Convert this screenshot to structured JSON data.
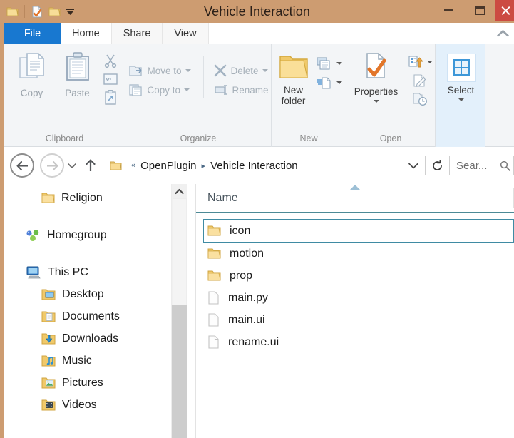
{
  "window": {
    "title": "Vehicle Interaction",
    "titlebar_color": "#cd9c71",
    "close_color": "#cc4b42",
    "accent_color": "#1878d0"
  },
  "quick_access": {
    "items": [
      {
        "name": "system-menu-folder",
        "icon": "folder-icon"
      },
      {
        "name": "properties",
        "icon": "properties-icon"
      },
      {
        "name": "new-folder",
        "icon": "new-folder-icon"
      },
      {
        "name": "customize-dropdown",
        "icon": "chevron-down-icon"
      }
    ]
  },
  "window_controls": {
    "minimize": "Minimize",
    "maximize": "Maximize",
    "close": "Close"
  },
  "tabs": {
    "file": "File",
    "items": [
      {
        "label": "Home",
        "active": true
      },
      {
        "label": "Share",
        "active": false
      },
      {
        "label": "View",
        "active": false
      }
    ],
    "collapse_ribbon": "Collapse the Ribbon"
  },
  "ribbon": {
    "groups": [
      {
        "title": "Clipboard",
        "big": [
          {
            "label": "Copy",
            "enabled": false
          },
          {
            "label": "Paste",
            "enabled": false
          }
        ],
        "small": [
          {
            "label": "Cut",
            "icon": "scissors-icon",
            "enabled": false
          },
          {
            "label": "Copy path",
            "icon": "copy-path-icon",
            "enabled": false
          },
          {
            "label": "Paste shortcut",
            "icon": "paste-shortcut-icon",
            "enabled": false
          }
        ]
      },
      {
        "title": "Organize",
        "small": [
          {
            "label": "Move to",
            "icon": "move-to-icon",
            "enabled": false,
            "dropdown": true
          },
          {
            "label": "Copy to",
            "icon": "copy-to-icon",
            "enabled": false,
            "dropdown": true
          },
          {
            "label": "Delete",
            "icon": "delete-icon",
            "enabled": false,
            "dropdown": true
          },
          {
            "label": "Rename",
            "icon": "rename-icon",
            "enabled": false
          }
        ]
      },
      {
        "title": "New",
        "big": [
          {
            "label": "New folder",
            "enabled": true
          }
        ],
        "small": [
          {
            "label": "New item",
            "icon": "new-item-icon",
            "enabled": true,
            "dropdown": true
          },
          {
            "label": "Easy access",
            "icon": "easy-access-icon",
            "enabled": true,
            "dropdown": true
          }
        ]
      },
      {
        "title": "Open",
        "big": [
          {
            "label": "Properties",
            "enabled": true,
            "dropdown": true
          }
        ],
        "small": [
          {
            "label": "Open",
            "icon": "open-icon",
            "enabled": true,
            "dropdown": true
          },
          {
            "label": "Edit",
            "icon": "edit-icon",
            "enabled": false
          },
          {
            "label": "History",
            "icon": "history-icon",
            "enabled": false
          }
        ]
      },
      {
        "title": "",
        "big": [
          {
            "label": "Select",
            "enabled": true,
            "dropdown": true,
            "highlighted": true
          }
        ]
      }
    ]
  },
  "address": {
    "back": "Back",
    "forward": "Forward",
    "recent_locations": "Recent locations",
    "up": "Up",
    "breadcrumb_overflow": "«",
    "breadcrumbs": [
      "OpenPlugin",
      "Vehicle Interaction"
    ],
    "breadcrumb_separator": "▸",
    "dropdown": "Previous locations",
    "refresh": "Refresh",
    "search_placeholder": "Sear..."
  },
  "nav_pane": {
    "items": [
      {
        "label": "Religion",
        "icon": "folder-icon",
        "level": "child"
      },
      {
        "label": "Homegroup",
        "icon": "homegroup-icon",
        "level": "root"
      },
      {
        "label": "This PC",
        "icon": "computer-icon",
        "level": "root"
      },
      {
        "label": "Desktop",
        "icon": "desktop-folder-icon",
        "level": "child"
      },
      {
        "label": "Documents",
        "icon": "documents-folder-icon",
        "level": "child"
      },
      {
        "label": "Downloads",
        "icon": "downloads-folder-icon",
        "level": "child"
      },
      {
        "label": "Music",
        "icon": "music-folder-icon",
        "level": "child"
      },
      {
        "label": "Pictures",
        "icon": "pictures-folder-icon",
        "level": "child"
      },
      {
        "label": "Videos",
        "icon": "videos-folder-icon",
        "level": "child"
      }
    ]
  },
  "file_list": {
    "column_header": "Name",
    "sort": "ascending",
    "rows": [
      {
        "name": "icon",
        "type": "folder",
        "selected": true
      },
      {
        "name": "motion",
        "type": "folder",
        "selected": false
      },
      {
        "name": "prop",
        "type": "folder",
        "selected": false
      },
      {
        "name": "main.py",
        "type": "file",
        "selected": false
      },
      {
        "name": "main.ui",
        "type": "file",
        "selected": false
      },
      {
        "name": "rename.ui",
        "type": "file",
        "selected": false
      }
    ]
  }
}
